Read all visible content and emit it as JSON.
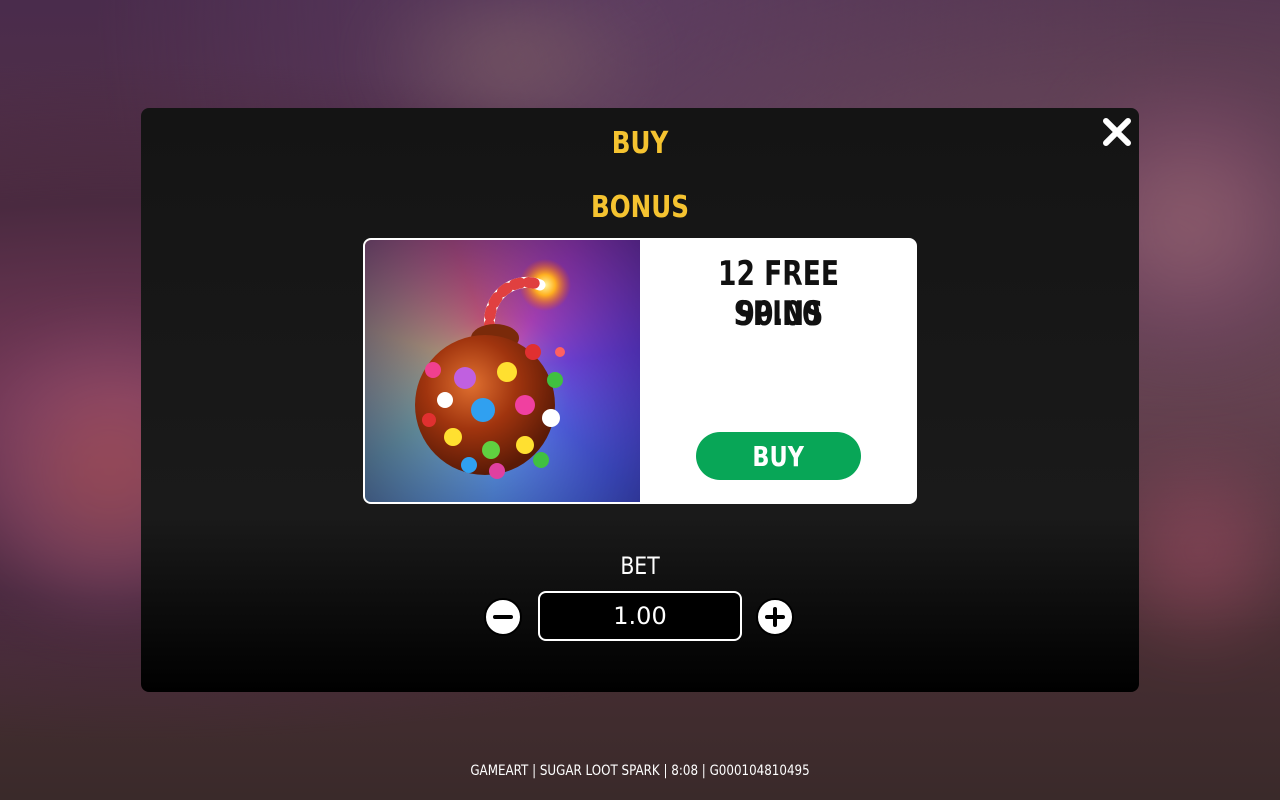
{
  "modal": {
    "title": "BUY",
    "close_icon": "close-icon",
    "section_title": "BONUS"
  },
  "bonus_card": {
    "image_icon": "candy-bomb-icon",
    "spins_label": "12 FREE SPINS",
    "price": "90.00",
    "buy_label": "BUY"
  },
  "bet": {
    "label": "BET",
    "value": "1.00",
    "decrease_icon": "minus-circle-icon",
    "increase_icon": "plus-circle-icon"
  },
  "footer": {
    "text": "GAMEART | SUGAR LOOT SPARK | 8:08 | G000104810495"
  },
  "colors": {
    "title_gold": "#f5c330",
    "buy_green": "#08a657",
    "modal_bg": "#141414"
  }
}
